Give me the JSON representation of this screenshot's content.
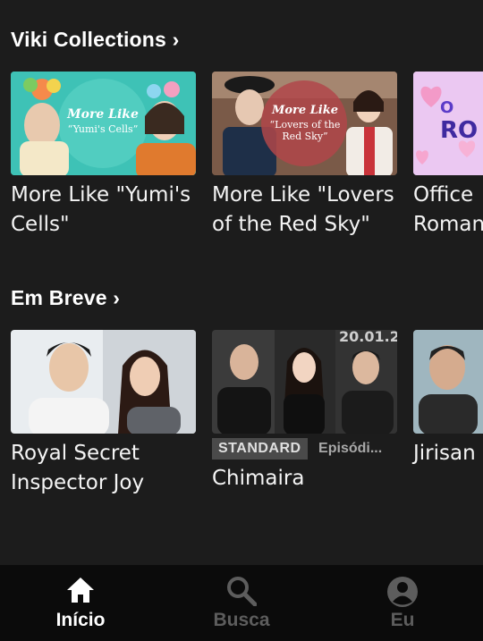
{
  "collections": {
    "title": "Viki Collections ›",
    "cards": [
      {
        "title": "More Like \"Yumi's Cells\"",
        "thumb_text_1": "More Like",
        "thumb_text_2": "“Yumi's Cells”"
      },
      {
        "title": "More Like \"Lovers of the Red Sky\"",
        "thumb_text_1": "More Like",
        "thumb_text_2": "“Lovers of the Red Sky”"
      },
      {
        "title": "Office Romance Dramas",
        "thumb_text_1": "O",
        "thumb_text_2": "RO"
      }
    ]
  },
  "coming_soon": {
    "title": "Em Breve ›",
    "cards": [
      {
        "title": "Royal Secret Inspector Joy"
      },
      {
        "title": "Chimaira",
        "badge": "STANDARD",
        "episode": "Episódi...",
        "thumb_text": "20.01.2"
      },
      {
        "title": "Jirisan"
      }
    ]
  },
  "nav": {
    "items": [
      {
        "label": "Início",
        "icon": "home-icon",
        "active": true
      },
      {
        "label": "Busca",
        "icon": "search-icon",
        "active": false
      },
      {
        "label": "Eu",
        "icon": "account-icon",
        "active": false
      }
    ]
  },
  "colors": {
    "background": "#1c1c1c",
    "nav_background": "#0b0b0b",
    "badge_background": "#4a4a4a",
    "inactive": "#5d5d5d"
  }
}
